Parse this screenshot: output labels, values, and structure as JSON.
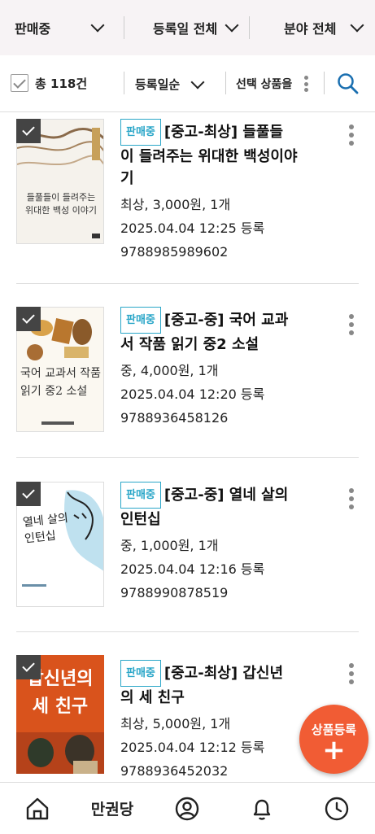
{
  "filters": [
    {
      "label": "판매중"
    },
    {
      "label": "등록일 전체"
    },
    {
      "label": "분야 전체"
    }
  ],
  "toolbar": {
    "total_label": "총 118건",
    "sort_label": "등록일순",
    "selected_label": "선택 상품을"
  },
  "items": [
    {
      "badge": "판매중",
      "title": "[중고-최상] 들풀들이 들려주는 위대한 백성이야기",
      "title_lines": [
        "[중고-최상] 들풀들",
        "이 들려주는 위대한 백성이야",
        "기"
      ],
      "price_line": "최상, 3,000원, 1개",
      "date_line": "2025.04.04 12:25 등록",
      "isbn": "9788985989602",
      "cover_text": "들풀들이 들려주는 위대한 백성 이야기"
    },
    {
      "badge": "판매중",
      "title": "[중고-중] 국어 교과서 작품 읽기 중2 소설",
      "title_lines": [
        "[중고-중] 국어 교과",
        "서 작품 읽기 중2 소설"
      ],
      "price_line": "중, 4,000원, 1개",
      "date_line": "2025.04.04 12:20 등록",
      "isbn": "9788936458126",
      "cover_text": "국어 교과서 작품 읽기 중2 소설"
    },
    {
      "badge": "판매중",
      "title": "[중고-중] 열네 살의 인턴십",
      "title_lines": [
        "[중고-중] 열네 살의",
        "인턴십"
      ],
      "price_line": "중, 1,000원, 1개",
      "date_line": "2025.04.04 12:16 등록",
      "isbn": "9788990878519",
      "cover_text": "열네 살의 인턴십"
    },
    {
      "badge": "판매중",
      "title": "[중고-최상] 갑신년의 세 친구",
      "title_lines": [
        "[중고-최상] 갑신년",
        "의 세 친구"
      ],
      "price_line": "최상, 5,000원, 1개",
      "date_line": "2025.04.04 12:12 등록",
      "isbn": "9788936452032",
      "cover_text": "갑신년의 세 친구"
    }
  ],
  "fab": {
    "label": "상품등록",
    "plus": "+"
  },
  "bottom_nav": {
    "store_label": "만권당"
  },
  "icons": [
    "chevron-down-icon",
    "search-icon",
    "more-vertical-icon",
    "home-icon",
    "profile-icon",
    "bell-icon",
    "clock-icon",
    "checkbox-icon"
  ],
  "colors": {
    "accent": "#2aa6c8",
    "fab": "#f15c34",
    "header_bg": "#f7f3f5"
  }
}
